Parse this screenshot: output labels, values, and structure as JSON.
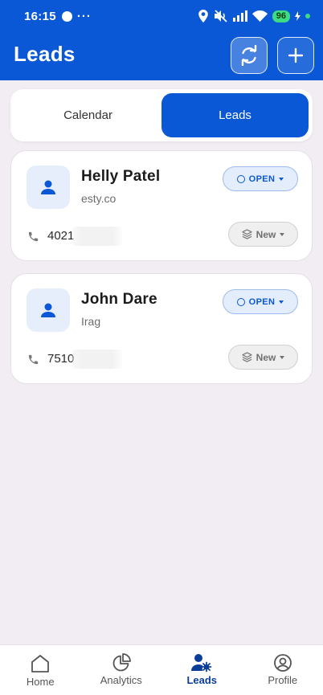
{
  "status_bar": {
    "time": "16:15",
    "dots": "···",
    "battery": "96"
  },
  "header": {
    "title": "Leads",
    "sync_icon": "sync-icon",
    "add_icon": "plus-icon"
  },
  "segment": {
    "tabs": [
      {
        "label": "Calendar",
        "active": false
      },
      {
        "label": "Leads",
        "active": true
      }
    ]
  },
  "leads": [
    {
      "name": "Helly Patel",
      "company": "esty.co",
      "status": "OPEN",
      "phone": "4021",
      "stage": "New"
    },
    {
      "name": "John Dare",
      "company": "Irag",
      "status": "OPEN",
      "phone": "7510",
      "stage": "New"
    }
  ],
  "bottom_nav": [
    {
      "label": "Home",
      "icon": "home-icon"
    },
    {
      "label": "Analytics",
      "icon": "pie-chart-icon"
    },
    {
      "label": "Leads",
      "icon": "leads-icon",
      "active": true
    },
    {
      "label": "Profile",
      "icon": "profile-icon"
    }
  ],
  "colors": {
    "primary": "#0a58d6",
    "background": "#f1edf2"
  }
}
